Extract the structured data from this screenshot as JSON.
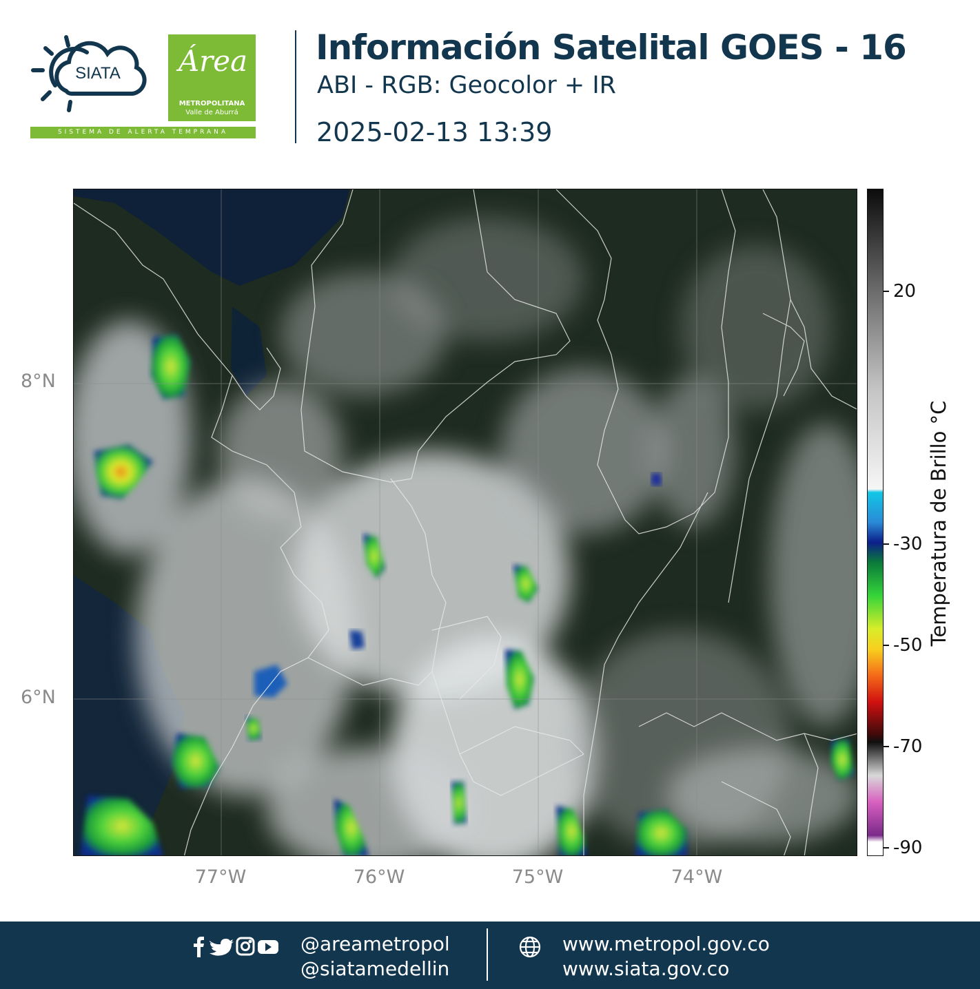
{
  "header": {
    "logo_siata_text": "SIATA",
    "logo_strap_text": "SISTEMA DE ALERTA TEMPRANA",
    "logo_area_script": "Área",
    "logo_area_line1": "METROPOLITANA",
    "logo_area_line2": "Valle de Aburrá",
    "title": "Información Satelital GOES - 16",
    "subtitle": "ABI - RGB: Geocolor + IR",
    "datetime": "2025-02-13 13:39"
  },
  "map": {
    "lat_labels": [
      "8°N",
      "6°N"
    ],
    "lon_labels": [
      "77°W",
      "76°W",
      "75°W",
      "74°W"
    ],
    "lat_values": [
      8,
      6
    ],
    "lon_values": [
      -77,
      -76,
      -75,
      -74
    ],
    "extent": {
      "lon_min": -77.93,
      "lon_max": -72.98,
      "lat_min": 4.75,
      "lat_max": 8.96
    }
  },
  "colorbar": {
    "title": "Temperatura de Brillo °C",
    "tick_labels": [
      "20",
      "-30",
      "-50",
      "-70",
      "-90"
    ],
    "tick_values": [
      20,
      -30,
      -50,
      -70,
      -90
    ],
    "range": [
      -90,
      30
    ]
  },
  "colors": {
    "navy": "#13364f",
    "brand_green": "#7dba35"
  },
  "footer": {
    "social_icons": [
      "facebook-icon",
      "twitter-icon",
      "instagram-icon",
      "youtube-icon"
    ],
    "handle1": "@areametropol",
    "handle2": "@siatamedellin",
    "url1": "www.metropol.gov.co",
    "url2": "www.siata.gov.co"
  }
}
